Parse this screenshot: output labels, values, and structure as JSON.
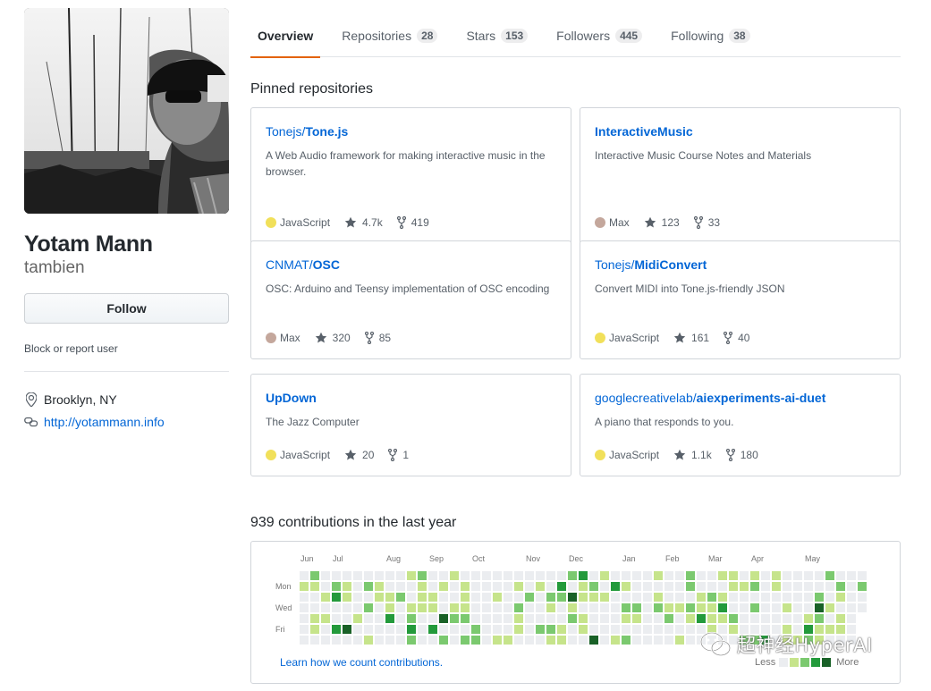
{
  "profile": {
    "name": "Yotam Mann",
    "login": "tambien",
    "follow_label": "Follow",
    "block_label": "Block or report user",
    "location": "Brooklyn, NY",
    "website": "http://yotammann.info"
  },
  "tabs": [
    {
      "label": "Overview",
      "count": null,
      "active": true
    },
    {
      "label": "Repositories",
      "count": "28",
      "active": false
    },
    {
      "label": "Stars",
      "count": "153",
      "active": false
    },
    {
      "label": "Followers",
      "count": "445",
      "active": false
    },
    {
      "label": "Following",
      "count": "38",
      "active": false
    }
  ],
  "pinned": {
    "title": "Pinned repositories",
    "repos": [
      {
        "owner": "Tonejs/",
        "name": "Tone.js",
        "description": "A Web Audio framework for making interactive music in the browser.",
        "language": "JavaScript",
        "lang_color": "#f1e05a",
        "stars": "4.7k",
        "forks": "419"
      },
      {
        "owner": "",
        "name": "InteractiveMusic",
        "description": "Interactive Music Course Notes and Materials",
        "language": "Max",
        "lang_color": "#c4a79c",
        "stars": "123",
        "forks": "33"
      },
      {
        "owner": "CNMAT/",
        "name": "OSC",
        "description": "OSC: Arduino and Teensy implementation of OSC encoding",
        "language": "Max",
        "lang_color": "#c4a79c",
        "stars": "320",
        "forks": "85"
      },
      {
        "owner": "Tonejs/",
        "name": "MidiConvert",
        "description": "Convert MIDI into Tone.js-friendly JSON",
        "language": "JavaScript",
        "lang_color": "#f1e05a",
        "stars": "161",
        "forks": "40"
      },
      {
        "owner": "",
        "name": "UpDown",
        "description": "The Jazz Computer",
        "language": "JavaScript",
        "lang_color": "#f1e05a",
        "stars": "20",
        "forks": "1"
      },
      {
        "owner": "googlecreativelab/",
        "name": "aiexperiments-ai-duet",
        "description": "A piano that responds to you.",
        "language": "JavaScript",
        "lang_color": "#f1e05a",
        "stars": "1.1k",
        "forks": "180"
      }
    ]
  },
  "contributions": {
    "title": "939 contributions in the last year",
    "months": [
      "Jun",
      "Jul",
      "Aug",
      "Sep",
      "Oct",
      "Nov",
      "Dec",
      "Jan",
      "Feb",
      "Mar",
      "Apr",
      "May"
    ],
    "days": [
      "Mon",
      "Wed",
      "Fri"
    ],
    "learn_link": "Learn how we count contributions.",
    "legend_less": "Less",
    "legend_more": "More",
    "colors": [
      "#ebedf0",
      "#c6e48b",
      "#7bc96f",
      "#239a3b",
      "#196127"
    ]
  },
  "watermark": {
    "text": "超神经HyperAI",
    "icon": "wechat-icon"
  }
}
